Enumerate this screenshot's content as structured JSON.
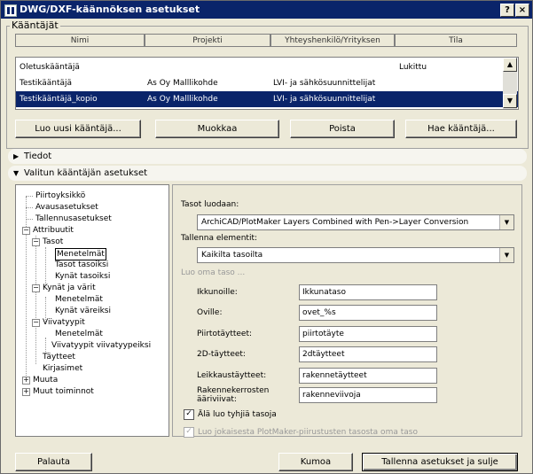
{
  "window": {
    "title": "DWG/DXF-käännöksen asetukset",
    "help_label": "?",
    "close_label": "×"
  },
  "translators": {
    "group_label": "Kääntäjät",
    "columns": [
      "Nimi",
      "Projekti",
      "Yhteyshenkilö/Yrityksen",
      "Tila"
    ],
    "rows": [
      {
        "name": "Oletuskääntäjä",
        "project": "",
        "contact": "",
        "status": "Lukittu"
      },
      {
        "name": "Testikääntäjä",
        "project": "As Oy Malllikohde",
        "contact": "LVI- ja sähkösuunnittelijat",
        "status": ""
      },
      {
        "name": "Testikääntäjä_kopio",
        "project": "As Oy Malllikohde",
        "contact": "LVI- ja sähkösuunnittelijat",
        "status": ""
      }
    ],
    "selected_row_index": 2,
    "buttons": {
      "new": "Luo uusi kääntäjä...",
      "edit": "Muokkaa",
      "delete": "Poista",
      "browse": "Hae kääntäjä..."
    }
  },
  "sections": {
    "info": "Tiedot",
    "settings": "Valitun kääntäjän asetukset"
  },
  "tree": {
    "nodes": {
      "piirtoyksikko": "Piirtoyksikkö",
      "avausasetukset": "Avausasetukset",
      "tallennusasetukset": "Tallennusasetukset",
      "attribuutit": "Attribuutit",
      "tasot": "Tasot",
      "menetelmat1": "Menetelmät",
      "tasot_tasoiksi": "Tasot tasoiksi",
      "kynat_tasoiksi": "Kynät tasoiksi",
      "kynat_ja_varit": "Kynät ja värit",
      "menetelmat2": "Menetelmät",
      "kynat_vareiksi": "Kynät väreiksi",
      "viivatyypit": "Viivatyypit",
      "menetelmat3": "Menetelmät",
      "viivatyypit_viivatyypeiksi": "Viivatyypit viivatyypeiksi",
      "taytteet": "Täytteet",
      "kirjasimet": "Kirjasimet",
      "muuta": "Muuta",
      "muut_toiminnot": "Muut toiminnot"
    }
  },
  "panel": {
    "create_layers_label": "Tasot luodaan:",
    "create_layers_value": "ArchiCAD/PlotMaker Layers Combined with Pen->Layer Conversion",
    "save_elements_label": "Tallenna elementit:",
    "save_elements_value": "Kaikilta tasoilta",
    "own_layer_heading": "Luo oma taso ...",
    "fields": [
      {
        "label": "Ikkunoille:",
        "value": "Ikkunataso"
      },
      {
        "label": "Oville:",
        "value": "ovet_%s"
      },
      {
        "label": "Piirtotäytteet:",
        "value": "piirtotäyte"
      },
      {
        "label": "2D-täytteet:",
        "value": "2dtäytteet"
      },
      {
        "label": "Leikkaustäytteet:",
        "value": "rakennetäytteet"
      },
      {
        "label": "Rakennekerrosten ääriviivat:",
        "value": "rakenneviivoja"
      }
    ],
    "chk_no_empty": {
      "label": "Älä luo tyhjiä tasoja",
      "checked": true
    },
    "chk_plotmaker": {
      "label": "Luo jokaisesta PlotMaker-piirustusten tasosta oma taso",
      "checked": true,
      "disabled": true
    }
  },
  "footer": {
    "cancel": "Palauta",
    "discard": "Kumoa",
    "save": "Tallenna asetukset ja sulje"
  }
}
